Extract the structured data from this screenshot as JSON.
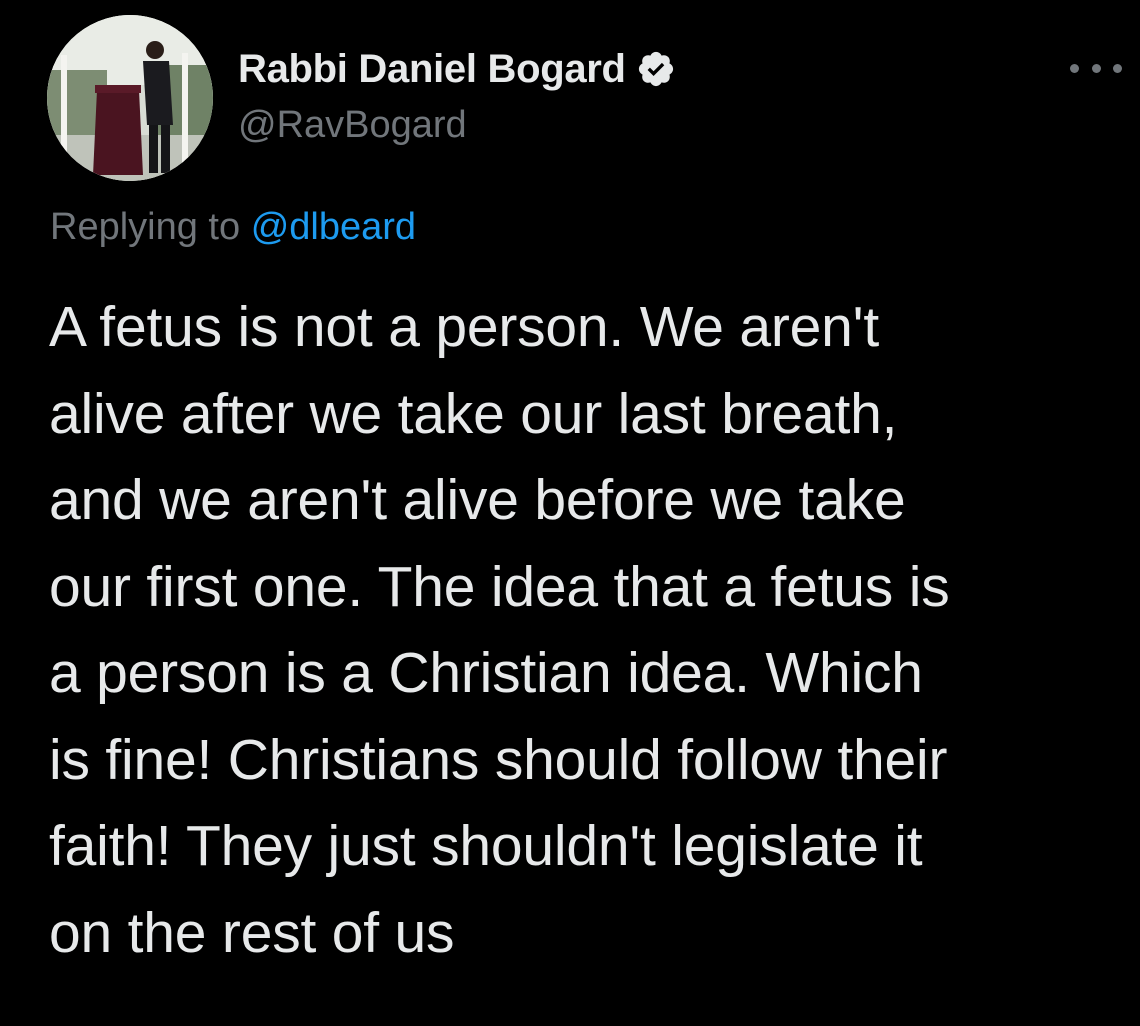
{
  "author": {
    "display_name": "Rabbi Daniel Bogard",
    "handle": "@RavBogard",
    "verified_icon": "verified-badge-icon",
    "avatar_icon": "profile-photo"
  },
  "more_menu": {
    "icon": "more-horizontal-icon"
  },
  "reply": {
    "prefix": "Replying to",
    "mention": "@dlbeard"
  },
  "tweet": {
    "lines": [
      "A fetus is not a person. We aren't",
      "alive after we take our last breath,",
      "and we aren't alive before we take",
      "our first one. The idea that a fetus is",
      "a person is a Christian idea. Which",
      "is fine! Christians should follow their",
      "faith! They just shouldn't legislate it",
      "on the rest of us"
    ]
  },
  "colors": {
    "background": "#000000",
    "primary_text": "#e7e9ea",
    "secondary_text": "#71767b",
    "link": "#1d9bf0"
  }
}
